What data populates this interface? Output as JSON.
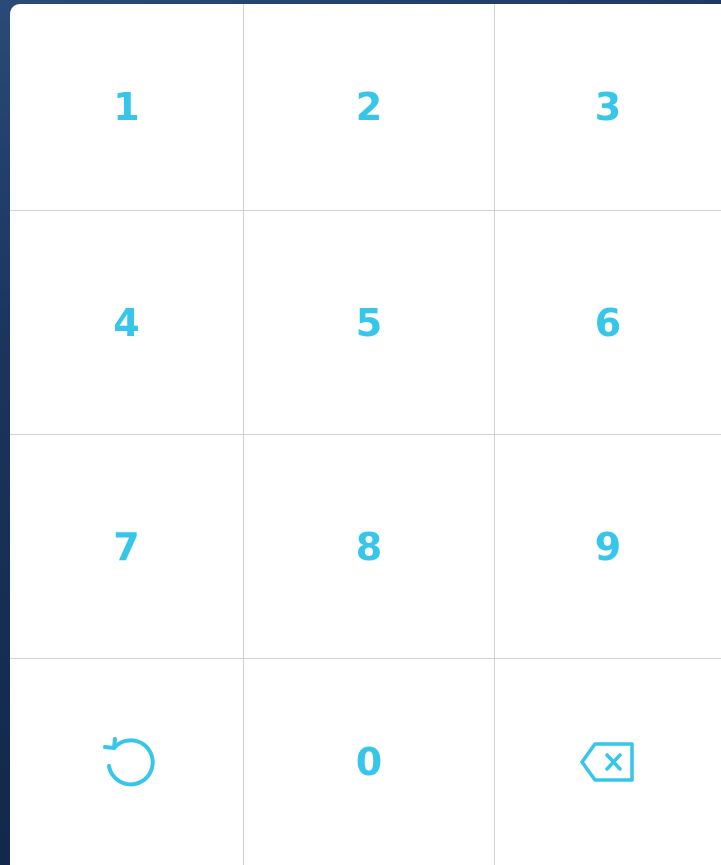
{
  "keypad": {
    "accent_color": "#35c6ea",
    "keys": [
      {
        "label": "1"
      },
      {
        "label": "2"
      },
      {
        "label": "3"
      },
      {
        "label": "4"
      },
      {
        "label": "5"
      },
      {
        "label": "6"
      },
      {
        "label": "7"
      },
      {
        "label": "8"
      },
      {
        "label": "9"
      },
      {
        "icon": "reset-icon"
      },
      {
        "label": "0"
      },
      {
        "icon": "backspace-icon"
      }
    ]
  }
}
